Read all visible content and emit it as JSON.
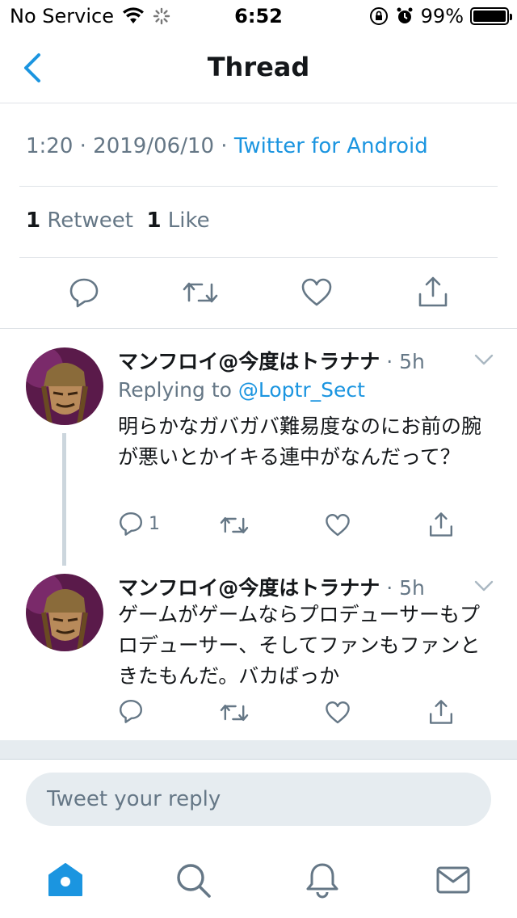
{
  "status_bar": {
    "carrier": "No Service",
    "time": "6:52",
    "battery_percent": "99%",
    "battery_level": 0.99
  },
  "nav": {
    "title": "Thread",
    "back_icon": "chevron-left-icon"
  },
  "main_tweet": {
    "timestamp": "1:20 · 2019/06/10 · ",
    "source": "Twitter for Android",
    "retweets_count": "1",
    "retweets_label": "Retweet",
    "likes_count": "1",
    "likes_label": "Like"
  },
  "replies": [
    {
      "name": "マンフロイ@今度はトラナナ",
      "time": " · 5h",
      "replying_prefix": "Replying to ",
      "replying_handle": "@Loptr_Sect",
      "text": "明らかなガバガバ難易度なのにお前の腕が悪いとかイキる連中がなんだって？",
      "reply_count": "1"
    },
    {
      "name": "マンフロイ@今度はトラナナ",
      "time": " · 5h",
      "text": "ゲームがゲームならプロデューサーもプロデューサー、そしてファンもファンときたもんだ。バカばっか",
      "reply_count": ""
    }
  ],
  "composer": {
    "placeholder": "Tweet your reply"
  },
  "tab_bar": {
    "items": [
      "home-icon",
      "search-icon",
      "notifications-icon",
      "messages-icon"
    ]
  },
  "colors": {
    "accent": "#1b95e0",
    "secondary_text": "#657786",
    "divider": "#dfe3e7"
  }
}
